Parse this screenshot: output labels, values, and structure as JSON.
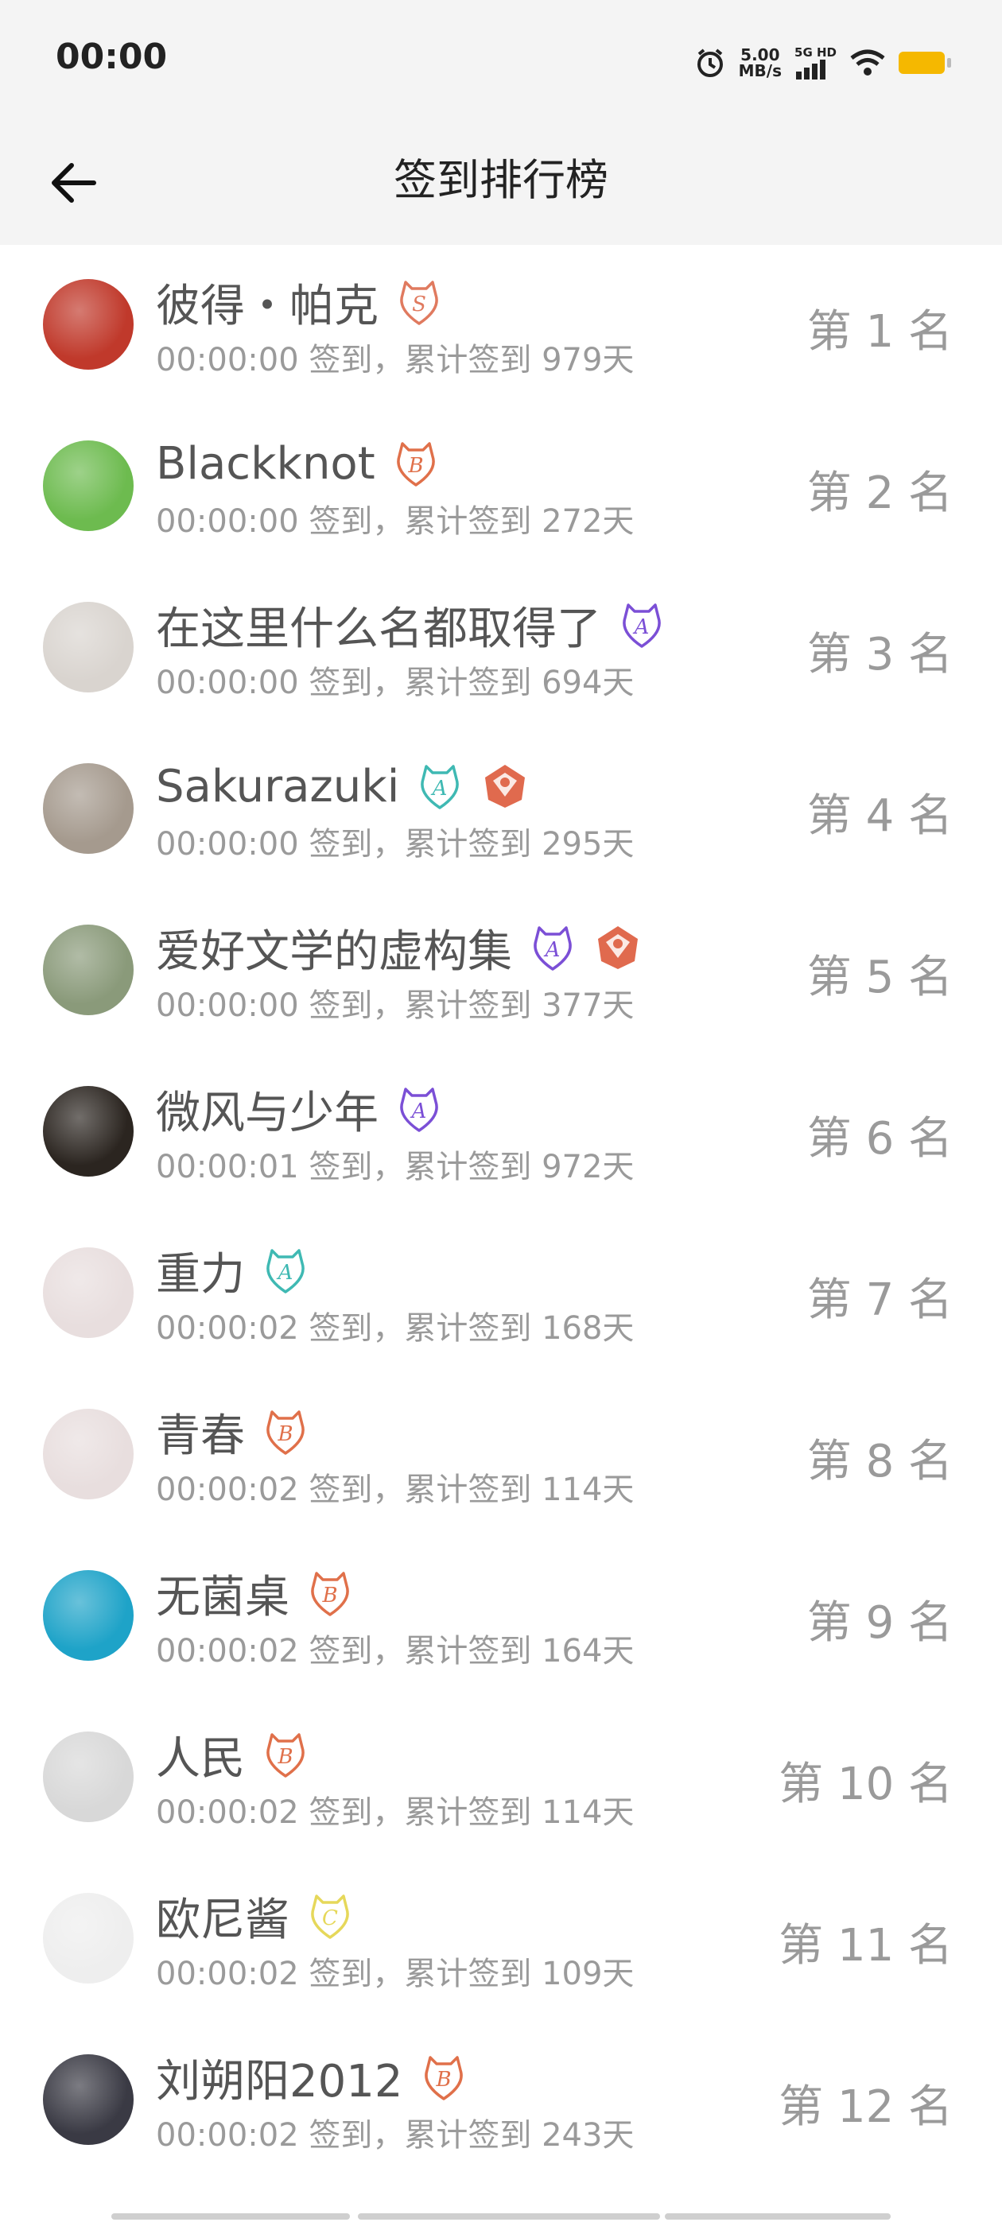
{
  "status": {
    "time": "00:00",
    "net_speed_value": "5.00",
    "net_speed_unit": "MB/s",
    "network_label": "5G HD"
  },
  "header": {
    "title": "签到排行榜"
  },
  "list": [
    {
      "name": "彼得・帕克",
      "time": "00:00:00 签到，累计签到 979天",
      "rank": "第 1 名",
      "badges": [
        {
          "letter": "S",
          "color": "#e07a5f"
        }
      ],
      "avatar_color": "#c0392b"
    },
    {
      "name": "Blackknot",
      "time": "00:00:00 签到，累计签到 272天",
      "rank": "第 2 名",
      "badges": [
        {
          "letter": "B",
          "color": "#e0704a"
        }
      ],
      "avatar_color": "#6dbb4f"
    },
    {
      "name": "在这里什么名都取得了",
      "time": "00:00:00 签到，累计签到 694天",
      "rank": "第 3 名",
      "badges": [
        {
          "letter": "A",
          "color": "#7b4fd6"
        }
      ],
      "avatar_color": "#d9d4cf"
    },
    {
      "name": "Sakurazuki",
      "time": "00:00:00 签到，累计签到 295天",
      "rank": "第 4 名",
      "badges": [
        {
          "letter": "A",
          "color": "#3fb9b3"
        },
        {
          "letter": "",
          "color": "#e06a4e"
        }
      ],
      "avatar_color": "#a59a8e"
    },
    {
      "name": "爱好文学的虚构集",
      "time": "00:00:00 签到，累计签到 377天",
      "rank": "第 5 名",
      "badges": [
        {
          "letter": "A",
          "color": "#7b4fd6"
        },
        {
          "letter": "",
          "color": "#e06a4e"
        }
      ],
      "avatar_color": "#8a9a7a"
    },
    {
      "name": "微风与少年",
      "time": "00:00:01 签到，累计签到 972天",
      "rank": "第 6 名",
      "badges": [
        {
          "letter": "A",
          "color": "#7b4fd6"
        }
      ],
      "avatar_color": "#2b2520"
    },
    {
      "name": "重力",
      "time": "00:00:02 签到，累计签到 168天",
      "rank": "第 7 名",
      "badges": [
        {
          "letter": "A",
          "color": "#3fb9b3"
        }
      ],
      "avatar_color": "#e8dede"
    },
    {
      "name": "青春",
      "time": "00:00:02 签到，累计签到 114天",
      "rank": "第 8 名",
      "badges": [
        {
          "letter": "B",
          "color": "#e0704a"
        }
      ],
      "avatar_color": "#e8dede"
    },
    {
      "name": "无菌桌",
      "time": "00:00:02 签到，累计签到 164天",
      "rank": "第 9 名",
      "badges": [
        {
          "letter": "B",
          "color": "#e0704a"
        }
      ],
      "avatar_color": "#1ea3c8"
    },
    {
      "name": "人民",
      "time": "00:00:02 签到，累计签到 114天",
      "rank": "第 10 名",
      "badges": [
        {
          "letter": "B",
          "color": "#e0704a"
        }
      ],
      "avatar_color": "#d8d8d8"
    },
    {
      "name": "欧尼酱",
      "time": "00:00:02 签到，累计签到 109天",
      "rank": "第 11 名",
      "badges": [
        {
          "letter": "C",
          "color": "#e6d85a"
        }
      ],
      "avatar_color": "#eeeeee"
    },
    {
      "name": "刘朔阳2012",
      "time": "00:00:02 签到，累计签到 243天",
      "rank": "第 12 名",
      "badges": [
        {
          "letter": "B",
          "color": "#e0704a"
        }
      ],
      "avatar_color": "#3a3a44"
    }
  ]
}
